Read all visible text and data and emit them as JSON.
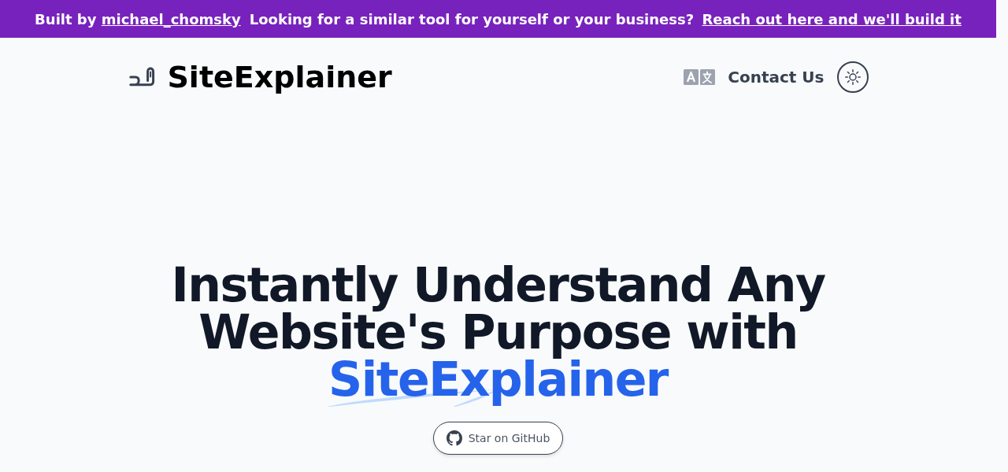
{
  "banner": {
    "prefix": "Built by",
    "author_link": "michael_chomsky",
    "message": "Looking for a similar tool for yourself or your business?",
    "cta_link": "Reach out here and we'll build it"
  },
  "header": {
    "logo_text": "SiteExplainer",
    "nav_link": "Contact Us"
  },
  "hero": {
    "title": "Instantly Understand Any Website's Purpose with",
    "highlight": "SiteExplainer",
    "button": "Star on GitHub"
  }
}
